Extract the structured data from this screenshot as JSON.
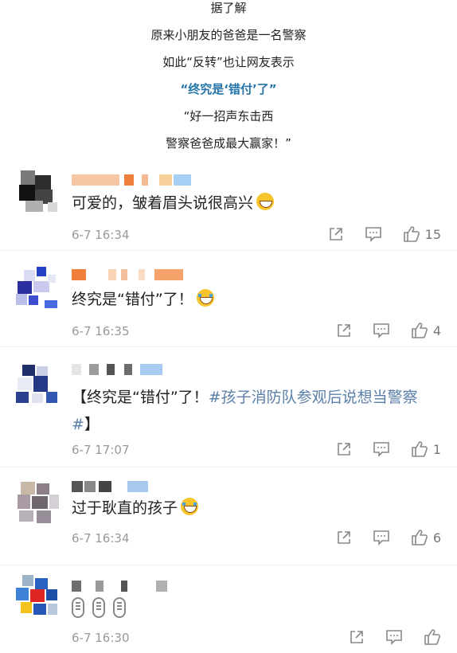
{
  "caption": {
    "lines": [
      "据了解",
      "原来小朋友的爸爸是一名警察",
      "如此“反转”也让网友表示",
      "“终究是‘错付’了”",
      "“好一招声东击西",
      "警察爸爸成最大赢家！”"
    ]
  },
  "comments": [
    {
      "text": "可爱的，皱着眉头说很高兴",
      "time": "6-7 16:34",
      "likes": "15"
    },
    {
      "text": "终究是“错付”了！",
      "time": "6-7 16:35",
      "likes": "4"
    },
    {
      "text_prefix": "【终究是“错付”了！",
      "topic": "#孩子消防队参观后说想当警察#",
      "text_suffix": "】",
      "time": "6-7 17:07",
      "likes": "1"
    },
    {
      "text": "过于耿直的孩子",
      "time": "6-7 16:34",
      "likes": "6"
    },
    {
      "time": "6-7 16:30"
    }
  ],
  "icons": {
    "share": "share-icon",
    "comment": "comment-icon",
    "like": "like-icon",
    "emoji": "laughing-emoji-icon",
    "mic": "microphone-icon"
  },
  "colors": {
    "highlight": "#2474a8",
    "topic": "#5b7fa8",
    "meta": "#999999"
  }
}
